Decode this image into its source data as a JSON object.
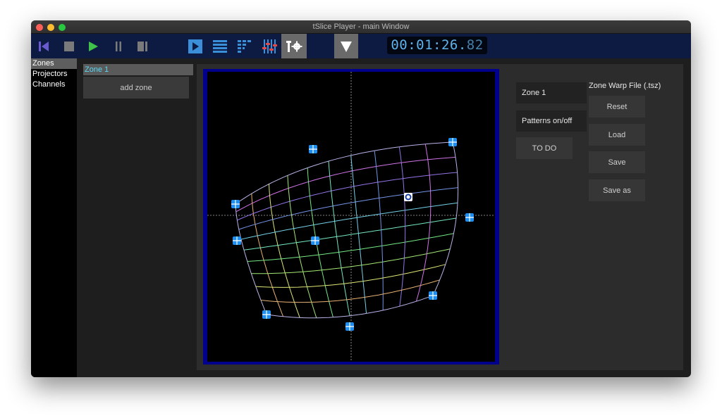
{
  "window": {
    "title": "tSlice Player - main Window"
  },
  "toolbar": {
    "timecode_main": "00:01:26.",
    "timecode_frames": "82",
    "accent_blue": "#3b8ed8",
    "play_green": "#3fc14a",
    "icons": [
      "skip-back-icon",
      "stop-icon",
      "play-icon",
      "pause-icon",
      "stop-frame-icon",
      "player-view-icon",
      "list-view-icon",
      "mapping-icon",
      "mixer-icon",
      "settings-icon",
      "dropdown-icon"
    ]
  },
  "sidebar": {
    "items": [
      {
        "label": "Zones",
        "selected": true
      },
      {
        "label": "Projectors",
        "selected": false
      },
      {
        "label": "Channels",
        "selected": false
      }
    ]
  },
  "zones": {
    "items": [
      {
        "label": "Zone 1",
        "selected": true
      }
    ],
    "add_label": "add zone"
  },
  "editor": {
    "zone_name": "Zone 1",
    "patterns_label": "Patterns on/off",
    "todo_label": "TO DO",
    "warp_file_label": "Zone Warp File (.tsz)",
    "reset_label": "Reset",
    "load_label": "Load",
    "save_label": "Save",
    "save_as_label": "Save as"
  }
}
